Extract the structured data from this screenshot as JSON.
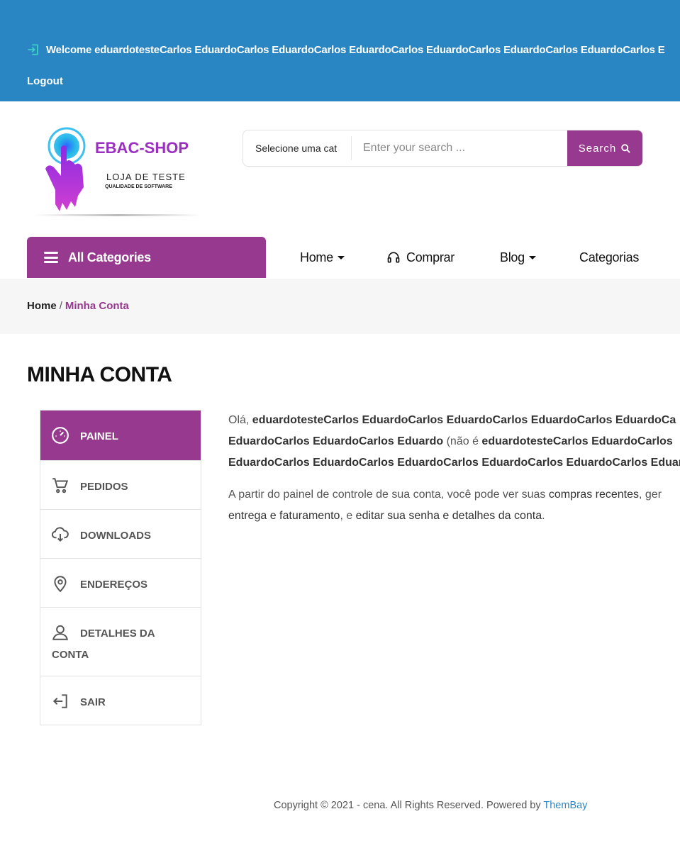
{
  "topbar": {
    "welcome": "Welcome eduardotesteCarlos EduardoCarlos EduardoCarlos EduardoCarlos EduardoCarlos EduardoCarlos EduardoCarlos E",
    "logout": "Logout",
    "bg_color": "#2a86c3",
    "login_icon": "sign-in-icon"
  },
  "logo": {
    "title": "EBAC-SHOP",
    "subtitle": "LOJA DE TESTE",
    "tagline": "QUALIDADE DE SOFTWARE"
  },
  "search": {
    "category": "Selecione uma cat",
    "placeholder": "Enter your search ...",
    "button": "Search"
  },
  "nav": {
    "all_categories": "All Categories",
    "items": [
      "Home",
      "Comprar",
      "Blog",
      "Categorias"
    ]
  },
  "breadcrumb": {
    "home": "Home",
    "separator": "/",
    "current": "Minha Conta"
  },
  "page": {
    "title": "MINHA CONTA"
  },
  "account_nav": [
    {
      "label": "PAINEL",
      "icon": "speedometer-icon",
      "active": true
    },
    {
      "label": "PEDIDOS",
      "icon": "cart-icon"
    },
    {
      "label": "DOWNLOADS",
      "icon": "cloud-download-icon"
    },
    {
      "label": "ENDEREÇOS",
      "icon": "location-pin-icon"
    },
    {
      "label": "DETALHES DA CONTA",
      "icon": "user-icon"
    },
    {
      "label": "SAIR",
      "icon": "logout-icon"
    }
  ],
  "content": {
    "greeting_prefix": "Olá, ",
    "user_line1": "eduardotesteCarlos EduardoCarlos EduardoCarlos EduardoCarlos EduardoCa",
    "user_line2": "EduardoCarlos EduardoCarlos Eduardo",
    "not_you": " (não é ",
    "user_line2b": "eduardotesteCarlos EduardoCarlos",
    "user_line3": "EduardoCarlos EduardoCarlos EduardoCarlos EduardoCarlos EduardoCarlos Eduar",
    "para_line1": "A partir do painel de controle de sua conta, você pode ver suas ",
    "recent_orders": "compras recentes",
    "para_line1b": ", ger",
    "addresses": "entrega e faturamento",
    "para_line2a": ", e ",
    "edit_link": "editar sua senha e detalhes da conta",
    "para_end": "."
  },
  "footer": {
    "copyright": "Copyright © 2021 - cena. All Rights Reserved. Powered by ",
    "brand": "ThemBay"
  },
  "colors": {
    "accent": "#97398f",
    "link": "#2a86c3"
  }
}
